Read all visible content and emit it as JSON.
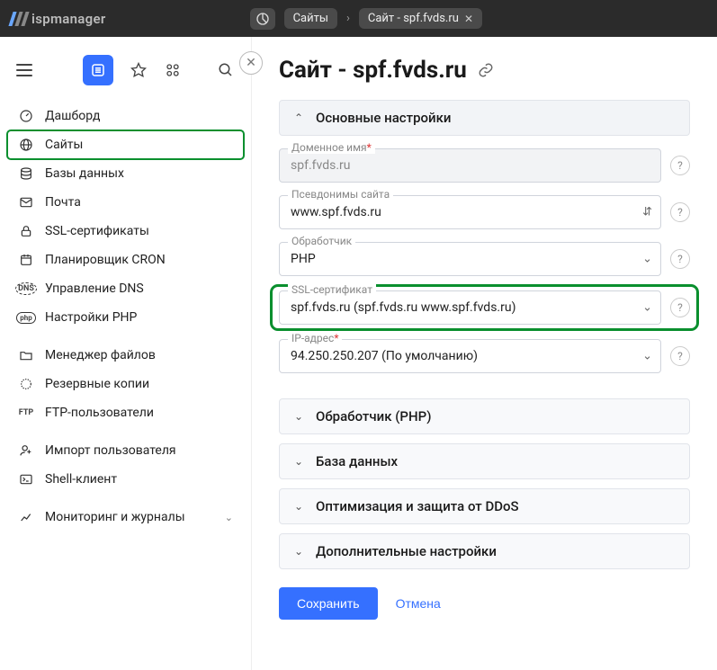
{
  "logo": {
    "text": "ispmanager"
  },
  "breadcrumb": {
    "tab1": "Сайты",
    "tab2": "Сайт - spf.fvds.ru"
  },
  "page_title": "Сайт - spf.fvds.ru",
  "sidebar": {
    "items": [
      {
        "label": "Дашборд"
      },
      {
        "label": "Сайты"
      },
      {
        "label": "Базы данных"
      },
      {
        "label": "Почта"
      },
      {
        "label": "SSL-сертификаты"
      },
      {
        "label": "Планировщик CRON"
      },
      {
        "label": "Управление DNS"
      },
      {
        "label": "Настройки PHP"
      },
      {
        "label": "Менеджер файлов"
      },
      {
        "label": "Резервные копии"
      },
      {
        "label": "FTP-пользователи"
      },
      {
        "label": "Импорт пользователя"
      },
      {
        "label": "Shell-клиент"
      },
      {
        "label": "Мониторинг и журналы"
      }
    ]
  },
  "accordions": {
    "main": "Основные настройки",
    "handler": "Обработчик (PHP)",
    "db": "База данных",
    "optim": "Оптимизация и защита от DDoS",
    "extra": "Дополнительные настройки"
  },
  "fields": {
    "domain": {
      "label": "Доменное имя",
      "value": "spf.fvds.ru"
    },
    "aliases": {
      "label": "Псевдонимы сайта",
      "value": "www.spf.fvds.ru"
    },
    "handler": {
      "label": "Обработчик",
      "value": "PHP"
    },
    "ssl": {
      "label": "SSL-сертификат",
      "value": "spf.fvds.ru (spf.fvds.ru www.spf.fvds.ru)"
    },
    "ip": {
      "label": "IP-адрес",
      "value": "94.250.250.207 (По умолчанию)"
    }
  },
  "buttons": {
    "save": "Сохранить",
    "cancel": "Отмена"
  }
}
